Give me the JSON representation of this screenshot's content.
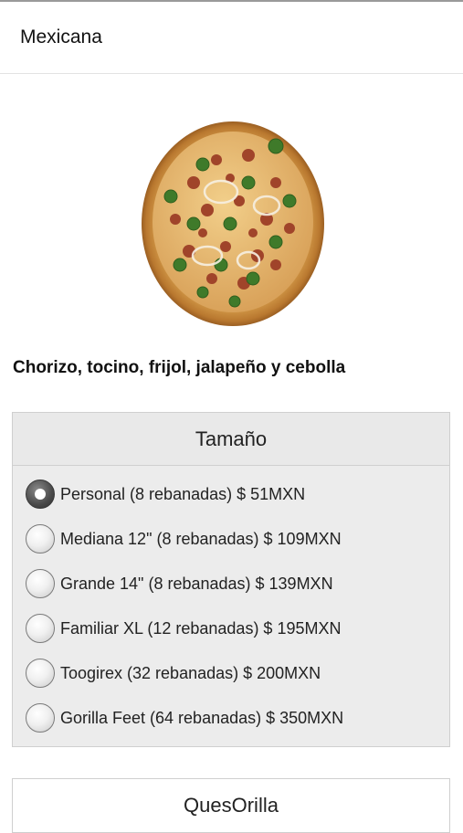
{
  "header": {
    "title": "Mexicana"
  },
  "product": {
    "image_icon": "pizza-image",
    "description": "Chorizo, tocino, frijol, jalapeño y cebolla"
  },
  "size_section": {
    "title": "Tamaño",
    "selected_index": 0,
    "options": [
      {
        "label": "Personal (8 rebanadas) $ 51MXN"
      },
      {
        "label": "Mediana 12\" (8 rebanadas) $ 109MXN"
      },
      {
        "label": "Grande 14\" (8 rebanadas) $ 139MXN"
      },
      {
        "label": "Familiar XL (12 rebanadas) $ 195MXN"
      },
      {
        "label": "Toogirex (32 rebanadas) $ 200MXN"
      },
      {
        "label": "Gorilla Feet (64 rebanadas) $ 350MXN"
      }
    ]
  },
  "next_section": {
    "title": "QuesOrilla"
  }
}
